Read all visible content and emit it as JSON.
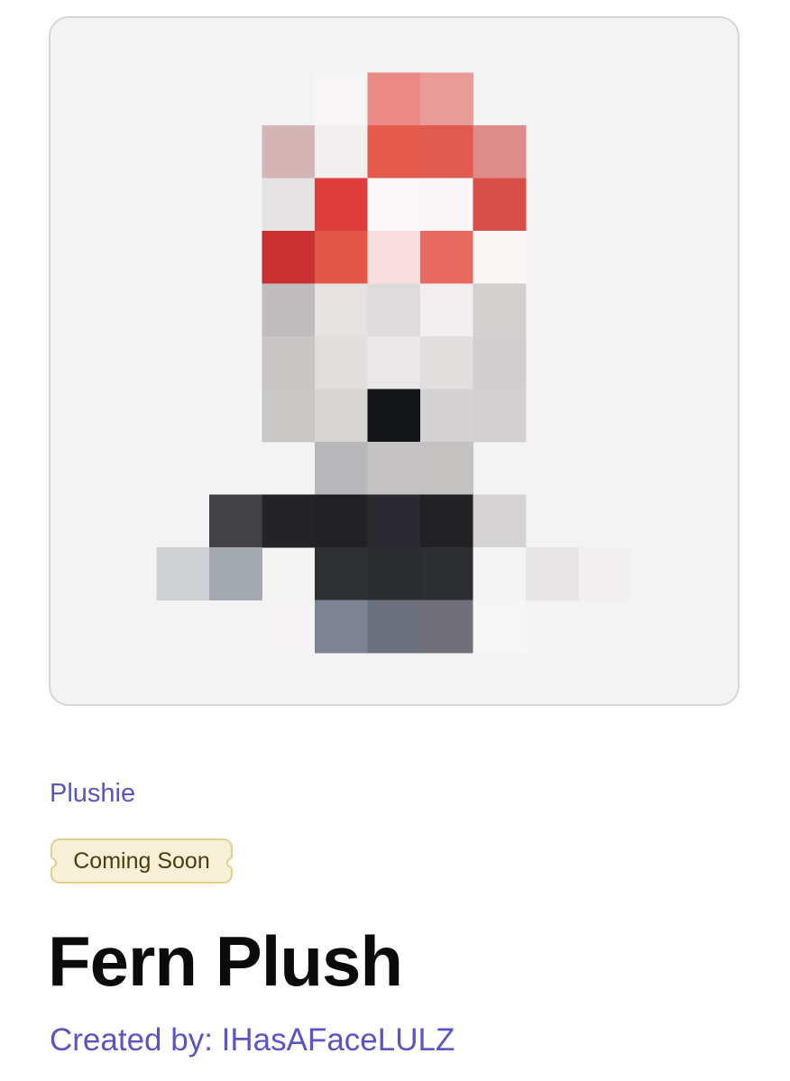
{
  "product": {
    "image_alt": "Fern Plush pixelated preview",
    "category": "Plushie",
    "status": "Coming Soon",
    "title": "Fern Plush",
    "creator_prefix": "Created by: ",
    "creator_name": "IHasAFaceLULZ"
  },
  "colors": {
    "accent": "#5a55c6",
    "badge_bg": "#f8f0d6",
    "badge_border": "#e2d08f",
    "card_bg": "#f3f3f4"
  },
  "pixel_grid": {
    "rows": [
      [
        "",
        "",
        "",
        "",
        "",
        "",
        "",
        "",
        "",
        "",
        "",
        "",
        ""
      ],
      [
        "",
        "",
        "",
        "",
        "",
        "#f7f5f5",
        "#e98a86",
        "#eb9b97",
        "",
        "",
        "",
        "",
        ""
      ],
      [
        "",
        "",
        "",
        "",
        "#d5b4b6",
        "#f1efef",
        "#e65a4c",
        "#e05a50",
        "#df8b89",
        "",
        "",
        "",
        ""
      ],
      [
        "",
        "",
        "",
        "",
        "#e4e2e2",
        "#de3e39",
        "#f9f7f8",
        "#f8f6f7",
        "#d94f48",
        "",
        "",
        "",
        ""
      ],
      [
        "",
        "",
        "",
        "",
        "#c8312f",
        "#e45748",
        "#f9dddf",
        "#e8695d",
        "#faf6f6",
        "",
        "",
        "",
        ""
      ],
      [
        "",
        "",
        "",
        "",
        "#c0bcbd",
        "#e5e3e1",
        "#dddbdc",
        "#f0eeef",
        "#d3cfcf",
        "",
        "",
        "",
        ""
      ],
      [
        "",
        "",
        "",
        "",
        "#c9c5c5",
        "#e1dede",
        "#e9e7e7",
        "#e1dede",
        "#d2cecf",
        "",
        "",
        "",
        ""
      ],
      [
        "",
        "",
        "",
        "",
        "#c9c6c6",
        "#d7d5d1",
        "#141518",
        "#d5d2d4",
        "#d4d0d1",
        "",
        "",
        "",
        ""
      ],
      [
        "",
        "",
        "",
        "",
        "",
        "#b8b8ba",
        "#c4c2c3",
        "#c4c1c1",
        "",
        "",
        "",
        "",
        ""
      ],
      [
        "",
        "",
        "",
        "#434246",
        "#242427",
        "#222226",
        "#2a2a30",
        "#222225",
        "#d6d3d4",
        "",
        "",
        "",
        ""
      ],
      [
        "",
        "",
        "#d0d1d5",
        "#a4a8af",
        "",
        "#2e2f33",
        "#2b2c30",
        "#2d2e32",
        "#f4f3f4",
        "#e6e4e5",
        "#f1eff0",
        "",
        ""
      ],
      [
        "",
        "",
        "",
        "",
        "#f4f2f3",
        "#7e8393",
        "#6d717e",
        "#717078",
        "#f7f6f6",
        "",
        "",
        "",
        ""
      ],
      [
        "",
        "",
        "",
        "",
        "",
        "",
        "",
        "",
        "",
        "",
        "",
        "",
        ""
      ]
    ]
  }
}
